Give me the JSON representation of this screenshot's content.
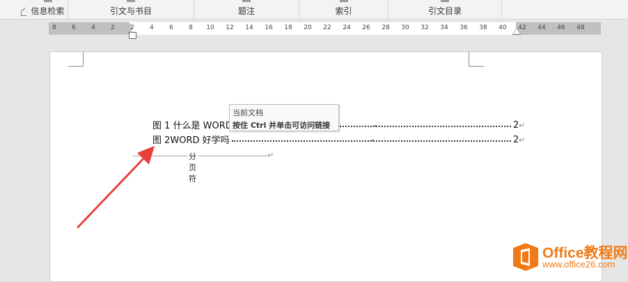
{
  "ribbon": {
    "groups": [
      {
        "label": "信息检索"
      },
      {
        "label": "引文与书目"
      },
      {
        "label": "题注"
      },
      {
        "label": "索引"
      },
      {
        "label": "引文目录"
      }
    ]
  },
  "ruler": {
    "numbers": [
      "8",
      "6",
      "4",
      "2",
      "2",
      "4",
      "6",
      "8",
      "10",
      "12",
      "14",
      "16",
      "18",
      "20",
      "22",
      "24",
      "26",
      "28",
      "30",
      "32",
      "34",
      "36",
      "38",
      "40",
      "42",
      "44",
      "46",
      "48"
    ]
  },
  "document": {
    "toc": [
      {
        "text": "图 1 什么是 WORD",
        "page": "2"
      },
      {
        "text": "图 2WORD 好学吗",
        "page": "2"
      }
    ],
    "page_break_label": "分页符",
    "paragraph_mark": "↵"
  },
  "tooltip": {
    "title": "当前文档",
    "hint": "按住 Ctrl 并单击可访问链接"
  },
  "watermark": {
    "brand": "Office教程网",
    "url": "www.office26.com",
    "color": "#f07a16"
  },
  "colors": {
    "arrow": "#e8413a",
    "accent": "#f07a16"
  }
}
